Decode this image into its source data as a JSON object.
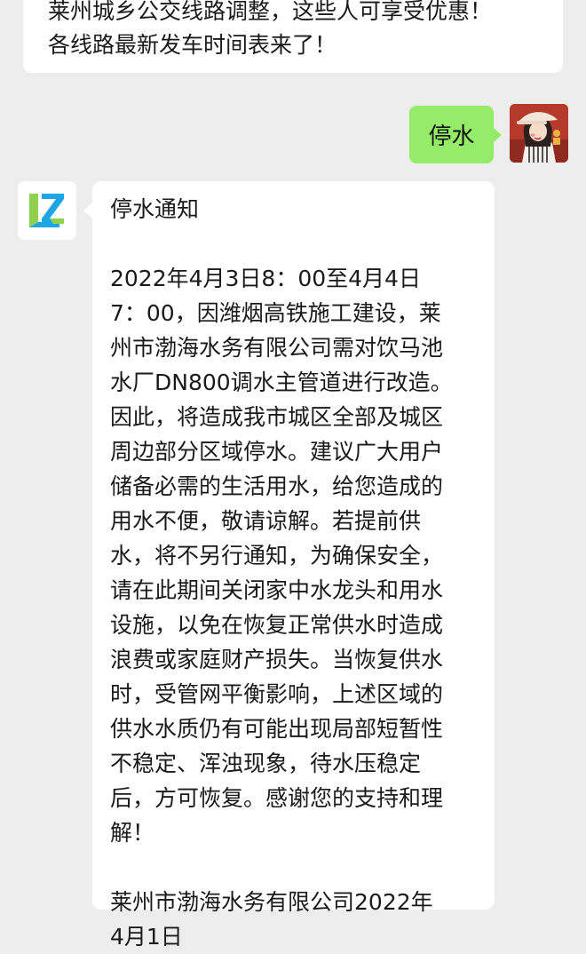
{
  "prev_message": {
    "lines": [
      "莱州城乡公交线路调整，这些人可享受优惠！",
      "各线路最新发车时间表来了！"
    ]
  },
  "user_message": {
    "text": "停水"
  },
  "bot_message": {
    "title": "停水通知",
    "body_lines": [
      "2022年4月3日8：00至4月4日",
      "7：00，因潍烟高铁施工建设，莱",
      "州市渤海水务有限公司需对饮马池",
      "水厂DN800调水主管道进行改造。",
      "因此，将造成我市城区全部及城区",
      "周边部分区域停水。建议广大用户",
      "储备必需的生活用水，给您造成的",
      "用水不便，敬请谅解。若提前供",
      "水，将不另行通知，为确保安全，",
      "请在此期间关闭家中水龙头和用水",
      "设施，以免在恢复正常供水时造成",
      "浪费或家庭财产损失。当恢复供水",
      "时，受管网平衡影响，上述区域的",
      "供水水质仍有可能出现局部短暂性",
      "不稳定、浑浊现象，待水压稳定",
      "后，方可恢复。感谢您的支持和理",
      "解！"
    ],
    "signature_lines": [
      "莱州市渤海水务有限公司2022年",
      "4月1日"
    ]
  },
  "colors": {
    "background": "#ededed",
    "user_bubble": "#95ec69",
    "bot_bubble": "#ffffff",
    "logo_blue": "#1ea5e6",
    "logo_green": "#8fd14f"
  }
}
